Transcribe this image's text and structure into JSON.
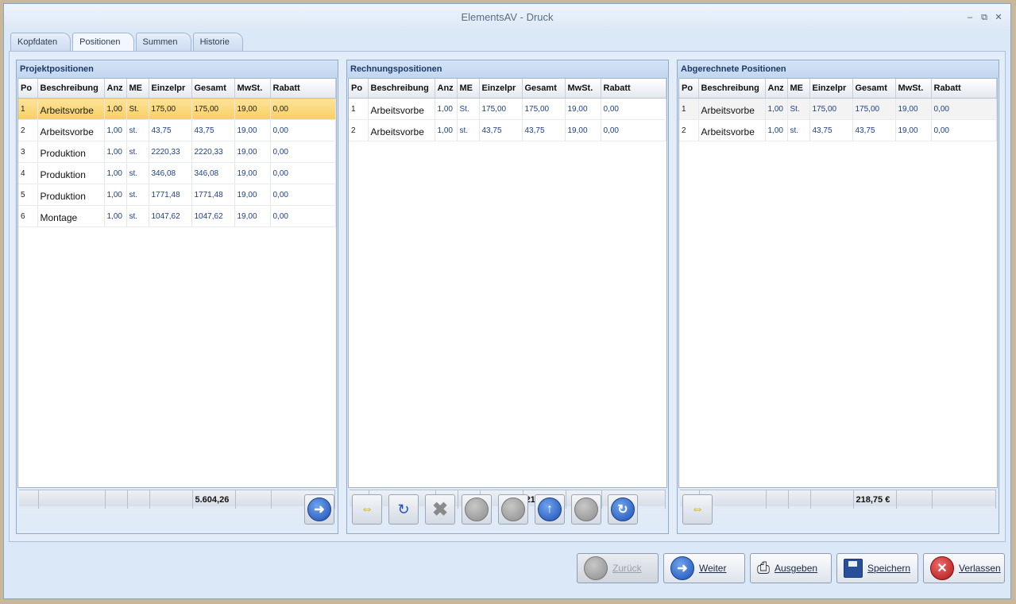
{
  "window": {
    "title": "ElementsAV  - Druck"
  },
  "tabs": [
    "Kopfdaten",
    "Positionen",
    "Summen",
    "Historie"
  ],
  "columns": [
    "Po",
    "Beschreibung",
    "Anz",
    "ME",
    "Einzelpr",
    "Gesamt",
    "MwSt.",
    "Rabatt"
  ],
  "projekt": {
    "title": "Projektpositionen",
    "rows": [
      [
        "1",
        "Arbeitsvorbe",
        "1,00",
        "St.",
        "175,00",
        "175,00",
        "19,00",
        "0,00"
      ],
      [
        "2",
        "Arbeitsvorbe",
        "1,00",
        "st.",
        "43,75",
        "43,75",
        "19,00",
        "0,00"
      ],
      [
        "3",
        "Produktion",
        "1,00",
        "st.",
        "2220,33",
        "2220,33",
        "19,00",
        "0,00"
      ],
      [
        "4",
        "Produktion",
        "1,00",
        "st.",
        "346,08",
        "346,08",
        "19,00",
        "0,00"
      ],
      [
        "5",
        "Produktion",
        "1,00",
        "st.",
        "1771,48",
        "1771,48",
        "19,00",
        "0,00"
      ],
      [
        "6",
        "Montage",
        "1,00",
        "st.",
        "1047,62",
        "1047,62",
        "19,00",
        "0,00"
      ]
    ],
    "total": "5.604,26"
  },
  "rechnung": {
    "title": "Rechnungspositionen",
    "rows": [
      [
        "1",
        "Arbeitsvorbe",
        "1,00",
        "St.",
        "175,00",
        "175,00",
        "19,00",
        "0,00"
      ],
      [
        "2",
        "Arbeitsvorbe",
        "1,00",
        "st.",
        "43,75",
        "43,75",
        "19,00",
        "0,00"
      ]
    ],
    "total": "218,75 €"
  },
  "abgerechnet": {
    "title": "Abgerechnete Positionen",
    "rows": [
      [
        "1",
        "Arbeitsvorbe",
        "1,00",
        "St.",
        "175,00",
        "175,00",
        "19,00",
        "0,00"
      ],
      [
        "2",
        "Arbeitsvorbe",
        "1,00",
        "st.",
        "43,75",
        "43,75",
        "19,00",
        "0,00"
      ]
    ],
    "total": "218,75 €"
  },
  "buttons": {
    "zurueck": "Zurück",
    "weiter": "Weiter",
    "ausgeben": "Ausgeben",
    "speichern": "Speichern",
    "verlassen": "Verlassen"
  },
  "colors": {
    "selection": "#f8cf62",
    "accent": "#1d4fb5",
    "danger": "#b01515"
  }
}
